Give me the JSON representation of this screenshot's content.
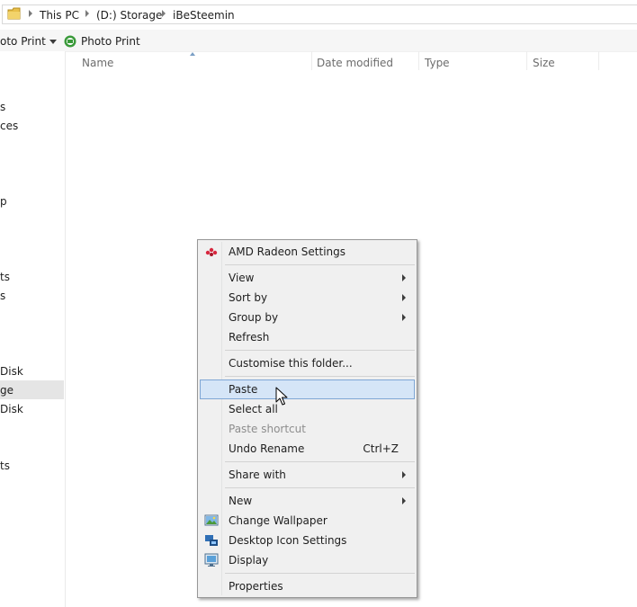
{
  "address": {
    "crumbs": [
      "This PC",
      "(D:) Storage",
      "iBeSteemin"
    ]
  },
  "toolbar": {
    "item1_label": "oto Print",
    "item2_label": "Photo Print"
  },
  "columns": [
    "Name",
    "Date modified",
    "Type",
    "Size"
  ],
  "nav": {
    "items": [
      "s",
      "ces",
      "p",
      "ts",
      "s",
      "Disk",
      "ge",
      "Disk",
      "ts"
    ]
  },
  "context_menu": {
    "amd": "AMD Radeon Settings",
    "view": "View",
    "sort_by": "Sort by",
    "group_by": "Group by",
    "refresh": "Refresh",
    "customise": "Customise this folder...",
    "paste": "Paste",
    "select_all": "Select all",
    "paste_shortcut": "Paste shortcut",
    "undo_rename": "Undo Rename",
    "undo_shortcut": "Ctrl+Z",
    "share_with": "Share with",
    "new": "New",
    "change_wallpaper": "Change Wallpaper",
    "desktop_icon_settings": "Desktop Icon Settings",
    "display": "Display",
    "properties": "Properties"
  },
  "colors": {
    "hover_fill": "#d5e5f7",
    "hover_border": "#7ea6d5",
    "menu_bg": "#f0f0f0",
    "amd_red": "#d7263d"
  }
}
